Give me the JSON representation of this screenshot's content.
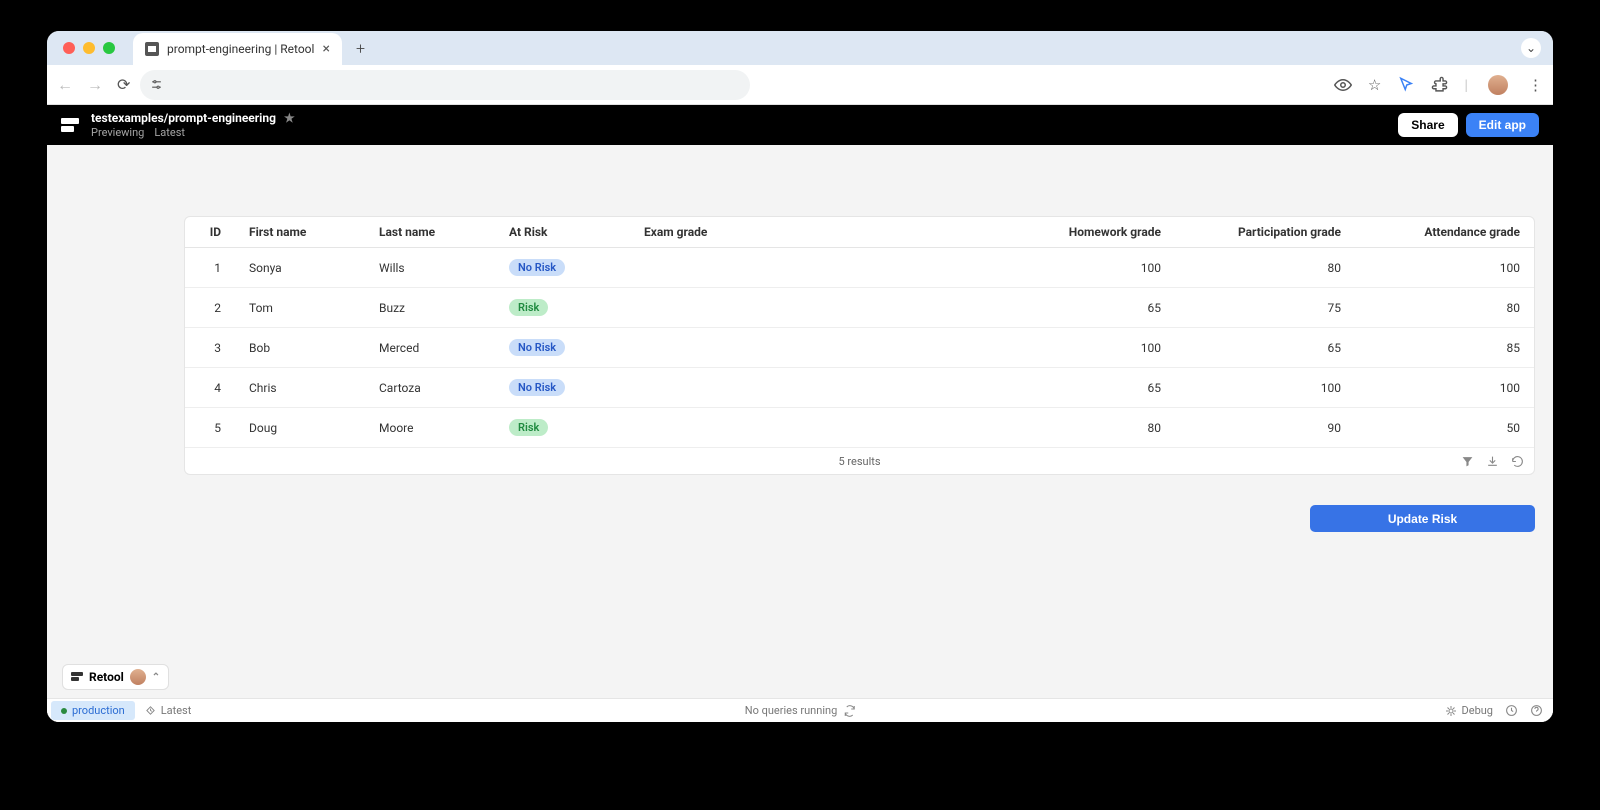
{
  "browser": {
    "tab_title": "prompt-engineering | Retool"
  },
  "appbar": {
    "path": "testexamples/prompt-engineering",
    "previewing": "Previewing",
    "latest": "Latest",
    "share": "Share",
    "edit": "Edit app"
  },
  "table": {
    "headers": {
      "id": "ID",
      "first_name": "First name",
      "last_name": "Last name",
      "at_risk": "At Risk",
      "exam": "Exam grade",
      "homework": "Homework grade",
      "participation": "Participation grade",
      "attendance": "Attendance grade"
    },
    "rows": [
      {
        "id": "1",
        "first": "Sonya",
        "last": "Wills",
        "risk": "No Risk",
        "risk_kind": "norisk",
        "exam": "",
        "hw": "100",
        "part": "80",
        "att": "100"
      },
      {
        "id": "2",
        "first": "Tom",
        "last": "Buzz",
        "risk": "Risk",
        "risk_kind": "risk",
        "exam": "",
        "hw": "65",
        "part": "75",
        "att": "80"
      },
      {
        "id": "3",
        "first": "Bob",
        "last": "Merced",
        "risk": "No Risk",
        "risk_kind": "norisk",
        "exam": "",
        "hw": "100",
        "part": "65",
        "att": "85"
      },
      {
        "id": "4",
        "first": "Chris",
        "last": "Cartoza",
        "risk": "No Risk",
        "risk_kind": "norisk",
        "exam": "",
        "hw": "65",
        "part": "100",
        "att": "100"
      },
      {
        "id": "5",
        "first": "Doug",
        "last": "Moore",
        "risk": "Risk",
        "risk_kind": "risk",
        "exam": "",
        "hw": "80",
        "part": "90",
        "att": "50"
      }
    ],
    "results": "5 results"
  },
  "buttons": {
    "update_risk": "Update Risk"
  },
  "retool_chip": "Retool",
  "statusbar": {
    "env": "production",
    "latest": "Latest",
    "center": "No queries running",
    "debug": "Debug"
  }
}
